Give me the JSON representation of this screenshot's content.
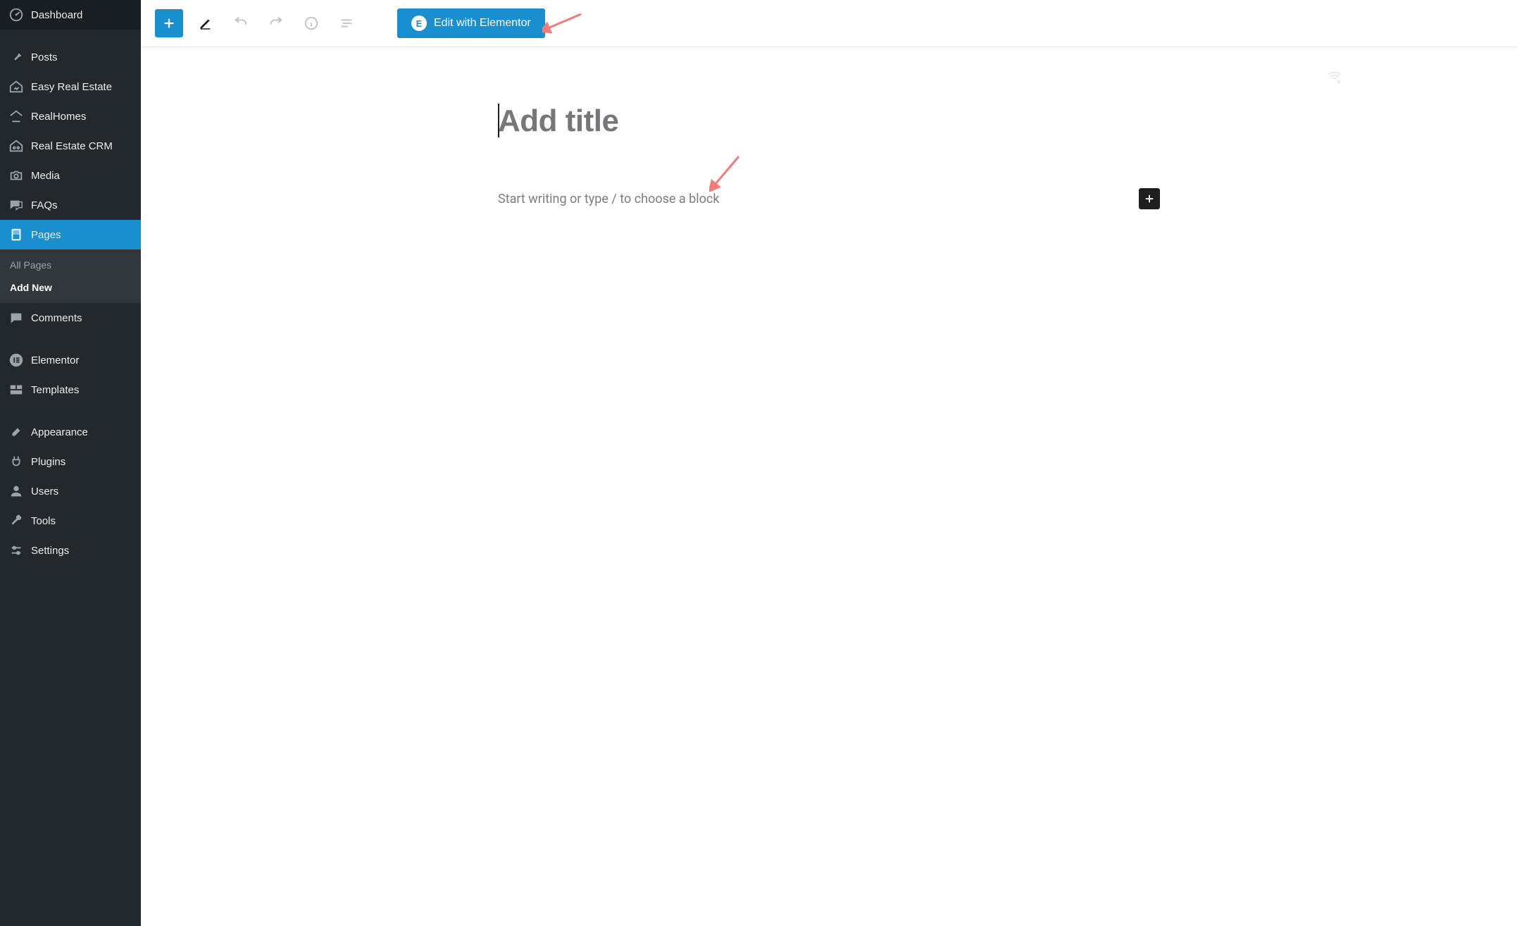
{
  "sidebar": {
    "items": [
      {
        "id": "dashboard",
        "label": "Dashboard",
        "icon": "gauge"
      },
      {
        "id": "posts",
        "label": "Posts",
        "icon": "pin"
      },
      {
        "id": "easy-real-estate",
        "label": "Easy Real Estate",
        "icon": "house-chart"
      },
      {
        "id": "realhomes",
        "label": "RealHomes",
        "icon": "house-arrow"
      },
      {
        "id": "real-estate-crm",
        "label": "Real Estate CRM",
        "icon": "house-people"
      },
      {
        "id": "media",
        "label": "Media",
        "icon": "camera"
      },
      {
        "id": "faqs",
        "label": "FAQs",
        "icon": "chat"
      },
      {
        "id": "pages",
        "label": "Pages",
        "icon": "page",
        "active": true
      },
      {
        "id": "comments",
        "label": "Comments",
        "icon": "comment"
      },
      {
        "id": "elementor",
        "label": "Elementor",
        "icon": "elementor"
      },
      {
        "id": "templates",
        "label": "Templates",
        "icon": "templates"
      },
      {
        "id": "appearance",
        "label": "Appearance",
        "icon": "brush"
      },
      {
        "id": "plugins",
        "label": "Plugins",
        "icon": "plug"
      },
      {
        "id": "users",
        "label": "Users",
        "icon": "user"
      },
      {
        "id": "tools",
        "label": "Tools",
        "icon": "wrench"
      },
      {
        "id": "settings",
        "label": "Settings",
        "icon": "sliders"
      }
    ],
    "submenu": {
      "parent": "pages",
      "items": [
        {
          "id": "all-pages",
          "label": "All Pages"
        },
        {
          "id": "add-new",
          "label": "Add New",
          "current": true
        }
      ]
    }
  },
  "toolbar": {
    "add_block_tooltip": "Add block",
    "edit_with_elementor": "Edit with Elementor",
    "elementor_logo_letter": "E"
  },
  "editor": {
    "title_placeholder": "Add title",
    "block_prompt": "Start writing or type / to choose a block"
  }
}
